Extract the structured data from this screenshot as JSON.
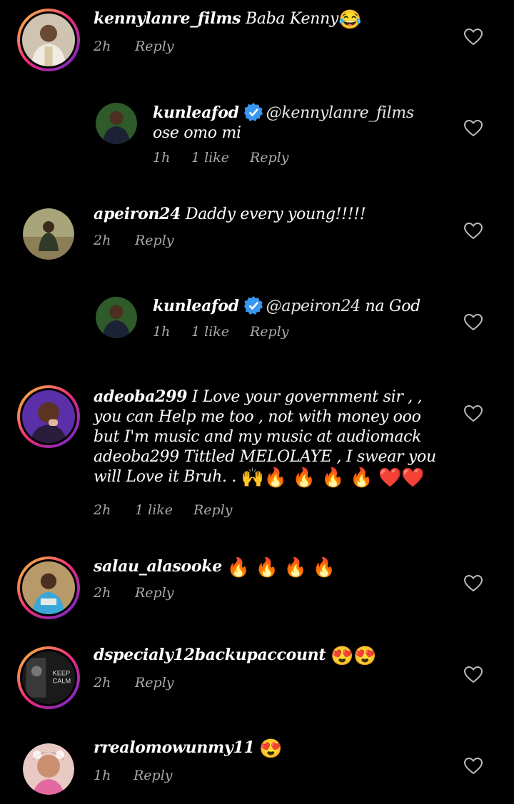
{
  "comments": [
    {
      "username": "kennylanre_films",
      "text": " Baba Kenny",
      "emoji": "😂",
      "time": "2h",
      "reply": "Reply"
    },
    {
      "username": "kunleafod",
      "mention": "@kennylanre_films",
      "text": " ose omo mi",
      "time": "1h",
      "likes": "1 like",
      "reply": "Reply"
    },
    {
      "username": "apeiron24",
      "text": " Daddy every young!!!!!",
      "time": "2h",
      "reply": "Reply"
    },
    {
      "username": "kunleafod",
      "mention": "@apeiron24",
      "text": " na God",
      "time": "1h",
      "likes": "1 like",
      "reply": "Reply"
    },
    {
      "username": "adeoba299",
      "text": " I Love your government sir , , you can Help me too ,  not with money ooo but I'm music and my music at audiomack adeoba299 Tittled MELOLAYE , I swear you will Love it Bruh. . ",
      "emoji": "🙌🔥 🔥 🔥 🔥 ❤️❤️",
      "time": "2h",
      "likes": "1 like",
      "reply": "Reply"
    },
    {
      "username": "salau_alasooke",
      "text": " ",
      "emoji": "🔥 🔥 🔥 🔥",
      "time": "2h",
      "reply": "Reply"
    },
    {
      "username": "dspecialy12backupaccount",
      "text": " ",
      "emoji": "😍😍",
      "time": "2h",
      "reply": "Reply"
    },
    {
      "username": "rrealomowunmy11",
      "text": " ",
      "emoji": "😍",
      "time": "1h",
      "reply": "Reply"
    }
  ],
  "icons": {
    "like": "heart-icon",
    "verified": "verified-badge-icon"
  },
  "colors": {
    "background": "#000000",
    "text": "#ffffff",
    "meta": "#a8a8a8",
    "verified": "#3897f0",
    "story_ring_start": "#f9ce34",
    "story_ring_end": "#ee2a7b"
  }
}
